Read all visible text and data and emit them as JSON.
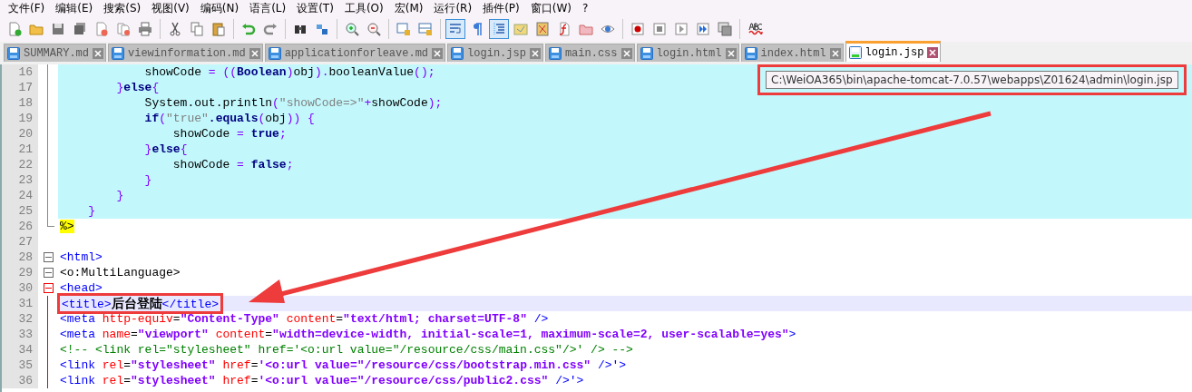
{
  "menu": [
    "文件(F)",
    "编辑(E)",
    "搜索(S)",
    "视图(V)",
    "编码(N)",
    "语言(L)",
    "设置(T)",
    "工具(O)",
    "宏(M)",
    "运行(R)",
    "插件(P)",
    "窗口(W)",
    "?"
  ],
  "toolbar": [
    {
      "pressed": false
    },
    {
      "pressed": false
    },
    {
      "pressed": false
    },
    {
      "pressed": false
    },
    {
      "pressed": false
    },
    {
      "pressed": false
    },
    {
      "pressed": false
    },
    {
      "pressed": false
    },
    {
      "pressed": false
    },
    {
      "pressed": false
    },
    {
      "pressed": false
    },
    {
      "pressed": false
    },
    {
      "pressed": false
    },
    {
      "pressed": false
    },
    {
      "pressed": false
    },
    {
      "pressed": false
    },
    {
      "pressed": false
    },
    {
      "pressed": false
    },
    {
      "pressed": true
    },
    {
      "pressed": false
    },
    {
      "pressed": true
    },
    {
      "pressed": false
    },
    {
      "pressed": false
    },
    {
      "pressed": false
    },
    {
      "pressed": false
    },
    {
      "pressed": false
    },
    {
      "pressed": false
    },
    {
      "pressed": false
    },
    {
      "pressed": false
    },
    {
      "pressed": false
    },
    {
      "pressed": false
    }
  ],
  "tabs": [
    {
      "label": "SUMMARY.md",
      "selected": false
    },
    {
      "label": "viewinformation.md",
      "selected": false
    },
    {
      "label": "applicationforleave.md",
      "selected": false
    },
    {
      "label": "login.jsp",
      "selected": false
    },
    {
      "label": "main.css",
      "selected": false
    },
    {
      "label": "login.html",
      "selected": false
    },
    {
      "label": "index.html",
      "selected": false
    },
    {
      "label": "login.jsp",
      "selected": true
    }
  ],
  "tooltip": {
    "text": "C:\\WeiOA365\\bin\\apache-tomcat-7.0.57\\webapps\\Z01624\\admin\\login.jsp",
    "outlined": true
  },
  "lines": [
    {
      "number": "16",
      "kind": "guide",
      "active": false,
      "block": true,
      "current": false,
      "outlined": false,
      "tokens": [
        {
          "kind": "plain",
          "text": "            showCode "
        },
        {
          "kind": "op",
          "text": "= (("
        },
        {
          "kind": "kw",
          "text": "Boolean"
        },
        {
          "kind": "op",
          "text": ")"
        },
        {
          "kind": "plain",
          "text": "obj"
        },
        {
          "kind": "op",
          "text": ")."
        },
        {
          "kind": "plain",
          "text": "booleanValue"
        },
        {
          "kind": "op",
          "text": "();"
        }
      ]
    },
    {
      "number": "17",
      "kind": "guide",
      "active": false,
      "block": true,
      "current": false,
      "outlined": false,
      "tokens": [
        {
          "kind": "op",
          "text": "        }"
        },
        {
          "kind": "kw",
          "text": "else"
        },
        {
          "kind": "op",
          "text": "{"
        }
      ]
    },
    {
      "number": "18",
      "kind": "guide",
      "active": false,
      "block": true,
      "current": false,
      "outlined": false,
      "tokens": [
        {
          "kind": "plain",
          "text": "            System.out.println"
        },
        {
          "kind": "op",
          "text": "("
        },
        {
          "kind": "str",
          "text": "\"showCode=>\""
        },
        {
          "kind": "op",
          "text": "+"
        },
        {
          "kind": "plain",
          "text": "showCode"
        },
        {
          "kind": "op",
          "text": ");"
        }
      ]
    },
    {
      "number": "19",
      "kind": "guide",
      "active": false,
      "block": true,
      "current": false,
      "outlined": false,
      "tokens": [
        {
          "kind": "kw",
          "text": "            if"
        },
        {
          "kind": "op",
          "text": "("
        },
        {
          "kind": "str",
          "text": "\"true\""
        },
        {
          "kind": "kw",
          "text": ".equals"
        },
        {
          "kind": "op",
          "text": "("
        },
        {
          "kind": "plain",
          "text": "obj"
        },
        {
          "kind": "op",
          "text": ")) {"
        }
      ]
    },
    {
      "number": "20",
      "kind": "guide",
      "active": false,
      "block": true,
      "current": false,
      "outlined": false,
      "tokens": [
        {
          "kind": "plain",
          "text": "                showCode "
        },
        {
          "kind": "op",
          "text": "= "
        },
        {
          "kind": "kw",
          "text": "true"
        },
        {
          "kind": "op",
          "text": ";"
        }
      ]
    },
    {
      "number": "21",
      "kind": "guide",
      "active": false,
      "block": true,
      "current": false,
      "outlined": false,
      "tokens": [
        {
          "kind": "op",
          "text": "            }"
        },
        {
          "kind": "kw",
          "text": "else"
        },
        {
          "kind": "op",
          "text": "{"
        }
      ]
    },
    {
      "number": "22",
      "kind": "guide",
      "active": false,
      "block": true,
      "current": false,
      "outlined": false,
      "tokens": [
        {
          "kind": "plain",
          "text": "                showCode "
        },
        {
          "kind": "op",
          "text": "= "
        },
        {
          "kind": "kw",
          "text": "false"
        },
        {
          "kind": "op",
          "text": ";"
        }
      ]
    },
    {
      "number": "23",
      "kind": "guide",
      "active": false,
      "block": true,
      "current": false,
      "outlined": false,
      "tokens": [
        {
          "kind": "op",
          "text": "            }"
        }
      ]
    },
    {
      "number": "24",
      "kind": "guide",
      "active": false,
      "block": true,
      "current": false,
      "outlined": false,
      "tokens": [
        {
          "kind": "op",
          "text": "        }"
        }
      ]
    },
    {
      "number": "25",
      "kind": "guide",
      "active": false,
      "block": true,
      "current": false,
      "outlined": false,
      "tokens": [
        {
          "kind": "op",
          "text": "    }"
        }
      ]
    },
    {
      "number": "26",
      "kind": "guide-end",
      "active": false,
      "block": false,
      "current": false,
      "outlined": false,
      "tokens": [
        {
          "kind": "jsp",
          "text": "%>"
        }
      ]
    },
    {
      "number": "27",
      "kind": "plain"
    },
    {
      "number": "28",
      "kind": "fold",
      "active": false,
      "block": false,
      "current": false,
      "outlined": false,
      "tokens": [
        {
          "kind": "tag",
          "text": "<html>"
        }
      ]
    },
    {
      "number": "29",
      "kind": "fold",
      "active": false,
      "block": false,
      "current": false,
      "outlined": false,
      "tokens": [
        {
          "kind": "plain",
          "text": "<o:MultiLanguage>"
        }
      ]
    },
    {
      "number": "30",
      "kind": "fold",
      "active": true,
      "block": false,
      "current": false,
      "outlined": false,
      "tokens": [
        {
          "kind": "tag",
          "text": "<head>"
        }
      ]
    },
    {
      "number": "31",
      "kind": "guide",
      "active": true,
      "block": false,
      "current": true,
      "outlined": true,
      "tokens": [
        {
          "kind": "tag",
          "text": "<title>"
        },
        {
          "kind": "cjk",
          "text": "后台登陆"
        },
        {
          "kind": "tag",
          "text": "</title>"
        }
      ]
    },
    {
      "number": "32",
      "kind": "guide",
      "active": true,
      "block": false,
      "current": false,
      "outlined": false,
      "tokens": [
        {
          "kind": "tag",
          "text": "<meta "
        },
        {
          "kind": "attr",
          "text": "http-equiv"
        },
        {
          "kind": "plain",
          "text": "="
        },
        {
          "kind": "val",
          "text": "\"Content-Type\""
        },
        {
          "kind": "attr",
          "text": " content"
        },
        {
          "kind": "plain",
          "text": "="
        },
        {
          "kind": "val",
          "text": "\"text/html; charset=UTF-8\""
        },
        {
          "kind": "tag",
          "text": " />"
        }
      ]
    },
    {
      "number": "33",
      "kind": "guide",
      "active": true,
      "block": false,
      "current": false,
      "outlined": false,
      "tokens": [
        {
          "kind": "tag",
          "text": "<meta "
        },
        {
          "kind": "attr",
          "text": "name"
        },
        {
          "kind": "plain",
          "text": "="
        },
        {
          "kind": "val",
          "text": "\"viewport\""
        },
        {
          "kind": "attr",
          "text": " content"
        },
        {
          "kind": "plain",
          "text": "="
        },
        {
          "kind": "val",
          "text": "\"width=device-width, initial-scale=1, maximum-scale=2, user-scalable=yes\""
        },
        {
          "kind": "tag",
          "text": ">"
        }
      ]
    },
    {
      "number": "34",
      "kind": "guide",
      "active": true,
      "block": false,
      "current": false,
      "outlined": false,
      "tokens": [
        {
          "kind": "comment",
          "text": "<!-- <link rel=\"stylesheet\" href='<o:url value=\"/resource/css/main.css\"/>' /> -->"
        }
      ]
    },
    {
      "number": "35",
      "kind": "guide",
      "active": true,
      "block": false,
      "current": false,
      "outlined": false,
      "tokens": [
        {
          "kind": "tag",
          "text": "<link "
        },
        {
          "kind": "attr",
          "text": "rel"
        },
        {
          "kind": "plain",
          "text": "="
        },
        {
          "kind": "val",
          "text": "\"stylesheet\""
        },
        {
          "kind": "attr",
          "text": " href"
        },
        {
          "kind": "plain",
          "text": "="
        },
        {
          "kind": "val",
          "text": "'<o:url value=\"/resource/css/bootstrap.min.css\" "
        },
        {
          "kind": "tag",
          "text": "/>'>"
        }
      ]
    },
    {
      "number": "36",
      "kind": "guide",
      "active": true,
      "block": false,
      "current": false,
      "outlined": false,
      "tokens": [
        {
          "kind": "tag",
          "text": "<link "
        },
        {
          "kind": "attr",
          "text": "rel"
        },
        {
          "kind": "plain",
          "text": "="
        },
        {
          "kind": "val",
          "text": "\"stylesheet\""
        },
        {
          "kind": "attr",
          "text": " href"
        },
        {
          "kind": "plain",
          "text": "="
        },
        {
          "kind": "val",
          "text": "'<o:url value=\"/resource/css/public2.css\" "
        },
        {
          "kind": "tag",
          "text": "/>'>"
        }
      ]
    }
  ]
}
